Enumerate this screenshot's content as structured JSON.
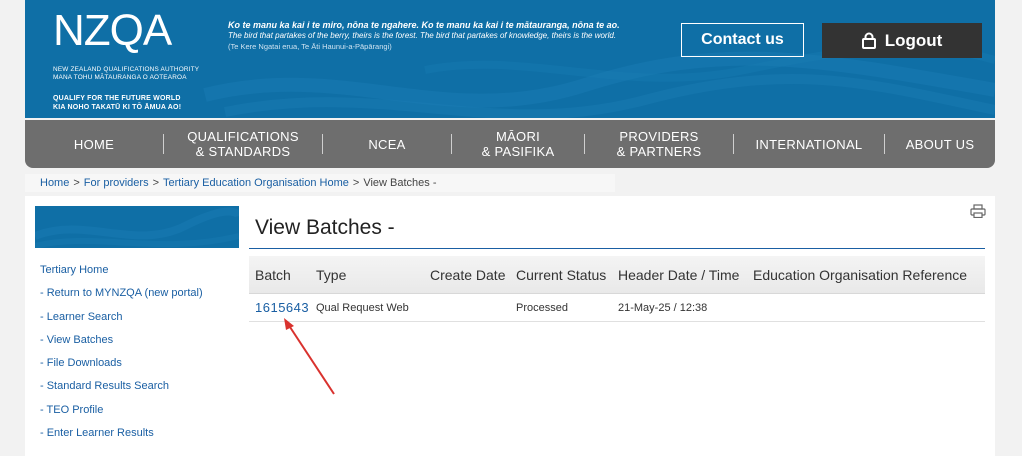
{
  "header": {
    "logo": {
      "name": "NZQA",
      "line1": "NEW ZEALAND QUALIFICATIONS AUTHORITY",
      "line2": "MANA TOHU MĀTAURANGA O AOTEAROA",
      "tag1": "QUALIFY FOR THE FUTURE WORLD",
      "tag2": "KIA NOHO TAKATŪ KI TŌ ĀMUA AO!"
    },
    "proverb_main": "Ko te manu ka kai i te miro, nōna te ngahere. Ko te manu ka kai i te mātauranga, nōna te ao.",
    "proverb_en": "The bird that partakes of the berry, theirs is the forest. The bird that partakes of knowledge, theirs is the world.",
    "proverb_cite": "(Te Kere Ngatai erua, Te Āti Haunui-a-Pāpārangi)",
    "contact_label": "Contact us",
    "logout_label": "Logout"
  },
  "nav": {
    "items": [
      {
        "line1": "HOME",
        "line2": ""
      },
      {
        "line1": "QUALIFICATIONS",
        "line2": "& STANDARDS"
      },
      {
        "line1": "NCEA",
        "line2": ""
      },
      {
        "line1": "MĀORI",
        "line2": "& PASIFIKA"
      },
      {
        "line1": "PROVIDERS",
        "line2": "& PARTNERS"
      },
      {
        "line1": "INTERNATIONAL",
        "line2": ""
      },
      {
        "line1": "ABOUT US",
        "line2": ""
      }
    ]
  },
  "breadcrumb": {
    "items": [
      "Home",
      "For providers",
      "Tertiary Education Organisation Home"
    ],
    "current": "View Batches -"
  },
  "sidebar": {
    "items": [
      "Tertiary Home",
      "- Return to MYNZQA (new portal)",
      "- Learner Search",
      "- View Batches",
      "- File Downloads",
      "- Standard Results Search",
      "- TEO Profile",
      "- Enter Learner Results"
    ]
  },
  "main": {
    "title": "View Batches -",
    "table": {
      "headers": [
        "Batch",
        "Type",
        "Create Date",
        "Current Status",
        "Header Date / Time",
        "Education Organisation Reference"
      ],
      "rows": [
        [
          "1615643",
          "Qual Request Web",
          "",
          "Processed",
          "21-May-25 / 12:38",
          ""
        ]
      ]
    }
  },
  "colors": {
    "brand_blue": "#0f6fa6",
    "nav_gray": "#6e6e6e",
    "link_blue": "#1a5fa3",
    "annotation_red": "#d9322e"
  }
}
